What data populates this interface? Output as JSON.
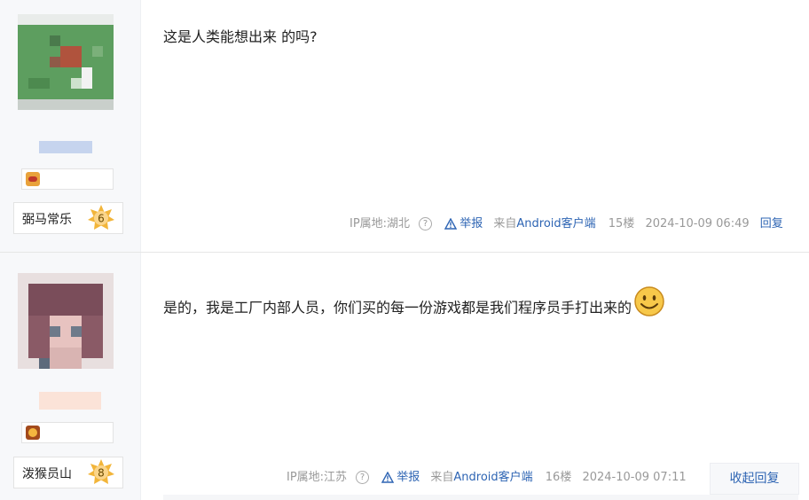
{
  "posts": [
    {
      "level_name": "弼马常乐",
      "level": "6",
      "content": "这是人类能想出来 的吗?",
      "ip": "IP属地:湖北",
      "report": "举报",
      "from_prefix": "来自",
      "client": "Android客户端",
      "floor": "15楼",
      "time": "2024-10-09 06:49",
      "reply": "回复"
    },
    {
      "level_name": "泼猴员山",
      "level": "8",
      "content": "是的，我是工厂内部人员，你们买的每一份游戏都是我们程序员手打出来的",
      "emoji": "smile-emoji",
      "ip": "IP属地:江苏",
      "report": "举报",
      "from_prefix": "来自",
      "client": "Android客户端",
      "floor": "16楼",
      "time": "2024-10-09 07:11",
      "collapse": "收起回复"
    }
  ],
  "colors": {
    "link": "#2d64b3",
    "meta": "#999999",
    "star": "#f2b53a"
  }
}
